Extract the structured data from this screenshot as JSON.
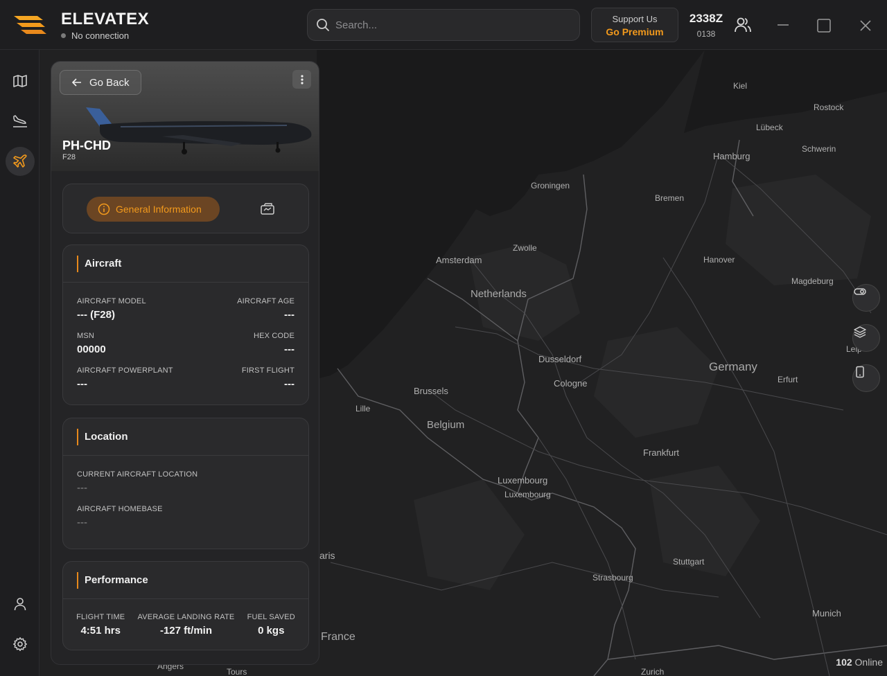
{
  "app": {
    "name": "ELEVATEX",
    "connection_status": "No connection"
  },
  "search": {
    "placeholder": "Search..."
  },
  "premium": {
    "line1": "Support Us",
    "line2": "Go Premium"
  },
  "clock": {
    "zulu": "2338Z",
    "local": "0138"
  },
  "icons": {
    "logo": "elevatex-logo",
    "search": "search-icon",
    "users": "users-icon",
    "minimize": "minimize-icon",
    "maximize": "maximize-icon",
    "close": "close-icon",
    "sidebar": [
      "map-icon",
      "landing-icon",
      "plane-icon",
      "user-icon",
      "gear-icon"
    ],
    "map_controls": [
      "toggle-icon",
      "layers-icon",
      "tablet-icon"
    ]
  },
  "colors": {
    "accent": "#f39a1c",
    "background": "#1b1b1c",
    "panel": "#242426",
    "card": "#2a2a2c"
  },
  "map": {
    "cities": [
      {
        "name": "Kiel"
      },
      {
        "name": "Rostock"
      },
      {
        "name": "Lübeck"
      },
      {
        "name": "Schwerin"
      },
      {
        "name": "Hamburg"
      },
      {
        "name": "Groningen"
      },
      {
        "name": "Bremen"
      },
      {
        "name": "Zwolle"
      },
      {
        "name": "Amsterdam"
      },
      {
        "name": "Hanover"
      },
      {
        "name": "Magdeburg"
      },
      {
        "name": "Dusseldorf"
      },
      {
        "name": "Cologne"
      },
      {
        "name": "Erfurt"
      },
      {
        "name": "Brussels"
      },
      {
        "name": "Lille"
      },
      {
        "name": "Frankfurt"
      },
      {
        "name": "Luxembourg"
      },
      {
        "name": "Luxembourg"
      },
      {
        "name": "Stuttgart"
      },
      {
        "name": "Strasbourg"
      },
      {
        "name": "Munich"
      },
      {
        "name": "aris"
      },
      {
        "name": "Angers"
      },
      {
        "name": "Tours"
      },
      {
        "name": "Zurich"
      },
      {
        "name": "Leip"
      }
    ],
    "countries": [
      "Netherlands",
      "Germany",
      "Belgium",
      "France"
    ],
    "online_count": "102",
    "online_label": "Online"
  },
  "panel": {
    "back_label": "Go Back",
    "registration": "PH-CHD",
    "aircraft_type": "F28",
    "tabs": {
      "active": "General Information"
    },
    "aircraft": {
      "title": "Aircraft",
      "fields": [
        {
          "left_label": "AIRCRAFT MODEL",
          "left_value": "--- (F28)",
          "right_label": "AIRCRAFT AGE",
          "right_value": "---"
        },
        {
          "left_label": "MSN",
          "left_value": "00000",
          "right_label": "HEX CODE",
          "right_value": "---"
        },
        {
          "left_label": "AIRCRAFT POWERPLANT",
          "left_value": "---",
          "right_label": "FIRST FLIGHT",
          "right_value": "---"
        }
      ]
    },
    "location": {
      "title": "Location",
      "current_label": "CURRENT AIRCRAFT LOCATION",
      "current_value": "---",
      "homebase_label": "AIRCRAFT HOMEBASE",
      "homebase_value": "---"
    },
    "performance": {
      "title": "Performance",
      "items": [
        {
          "label": "FLIGHT TIME",
          "value": "4:51 hrs"
        },
        {
          "label": "AVERAGE LANDING RATE",
          "value": "-127 ft/min"
        },
        {
          "label": "FUEL SAVED",
          "value": "0 kgs"
        }
      ]
    }
  }
}
